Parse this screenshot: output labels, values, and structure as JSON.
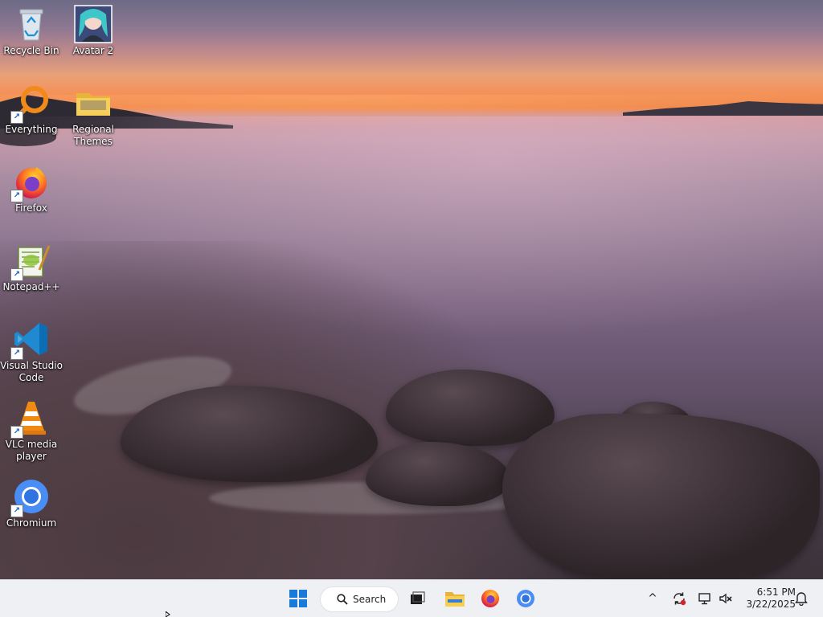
{
  "desktop": {
    "icons": [
      {
        "label": "Recycle Bin",
        "icon": "recycle-bin-icon"
      },
      {
        "label": "Avatar 2",
        "icon": "avatar-image-icon"
      },
      {
        "label": "Everything",
        "icon": "everything-search-icon"
      },
      {
        "label": "Regional Themes",
        "icon": "folder-icon"
      },
      {
        "label": "Firefox",
        "icon": "firefox-icon"
      },
      {
        "label": "Notepad++",
        "icon": "notepadpp-icon"
      },
      {
        "label": "Visual Studio Code",
        "icon": "vscode-icon"
      },
      {
        "label": "VLC media player",
        "icon": "vlc-icon"
      },
      {
        "label": "Chromium",
        "icon": "chromium-icon"
      }
    ]
  },
  "taskbar": {
    "start_icon": "windows-start-icon",
    "search_label": "Search",
    "pinned": [
      "task-view-icon",
      "file-explorer-icon",
      "firefox-icon",
      "chromium-icon"
    ],
    "tray": {
      "chevron": "^",
      "icons": [
        "sync-icon",
        "network-icon",
        "volume-muted-icon"
      ]
    },
    "clock": {
      "time": "6:51 PM",
      "date": "3/22/2025"
    },
    "notification_icon": "bell-icon"
  },
  "colors": {
    "taskbar_bg": "#eef0f4",
    "accent": "#0067c0"
  }
}
